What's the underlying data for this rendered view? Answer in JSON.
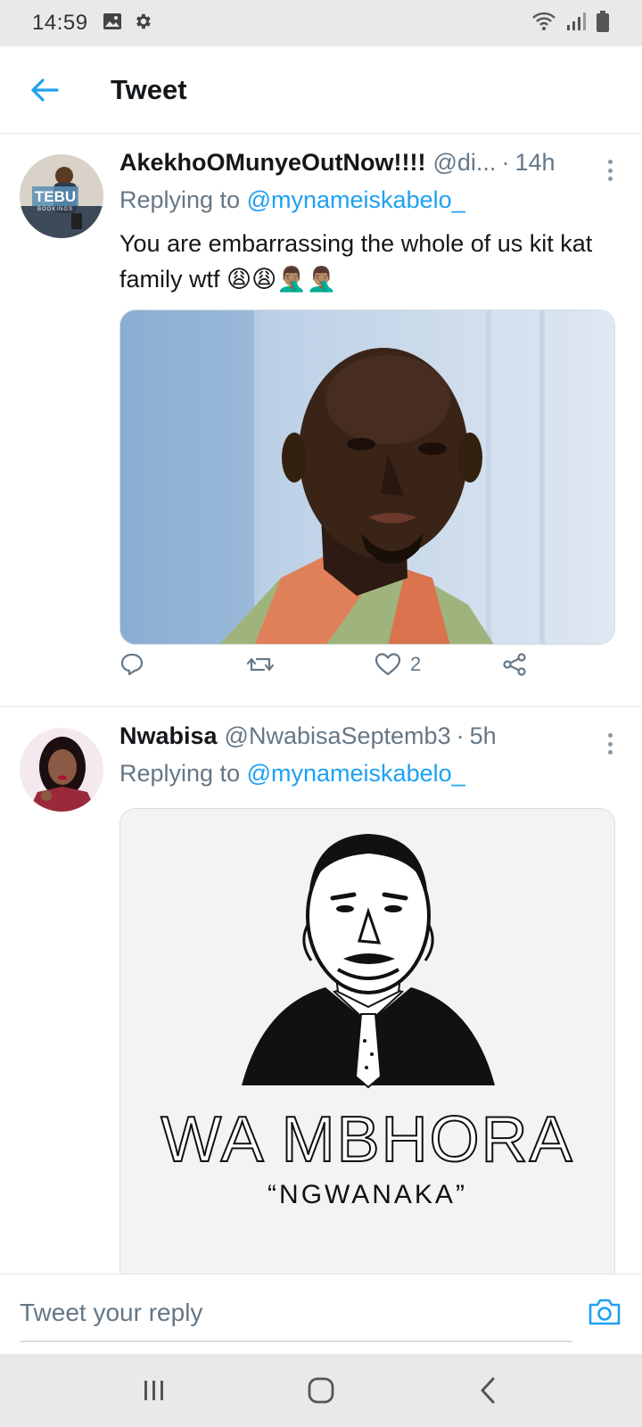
{
  "status_bar": {
    "time": "14:59",
    "icons": [
      "image-icon",
      "gear-icon",
      "wifi-icon",
      "signal-icon",
      "battery-icon"
    ]
  },
  "header": {
    "title": "Tweet",
    "back_icon": "arrow-left-icon"
  },
  "tweets": [
    {
      "display_name": "AkekhoOMunyeOutNow!!!!",
      "handle": "@di...",
      "time": "14h",
      "replying_prefix": "Replying to",
      "replying_to": "@mynameiskabelo_",
      "text": "You are embarrassing the whole of us kit kat family wtf 😩😩🤦🏽‍♂️🤦🏽‍♂️",
      "avatar_text": "TEBU",
      "avatar_subtext": "BOOKINGS",
      "actions": {
        "reply": "",
        "retweet": "",
        "like": "2",
        "share": ""
      }
    },
    {
      "display_name": "Nwabisa",
      "handle": "@NwabisaSeptemb3",
      "time": "5h",
      "replying_prefix": "Replying to",
      "replying_to": "@mynameiskabelo_",
      "image_title": "WA MBHORA",
      "image_subtitle": "“NGWANAKA”"
    }
  ],
  "reply_bar": {
    "placeholder": "Tweet your reply",
    "camera_icon": "camera-icon"
  },
  "nav_bar": {
    "icons": [
      "recents-icon",
      "home-icon",
      "back-icon"
    ]
  },
  "colors": {
    "accent": "#1da1f2",
    "secondary_text": "#657786",
    "divider": "#e1e8ed",
    "system_bar": "#e9e9ea"
  }
}
